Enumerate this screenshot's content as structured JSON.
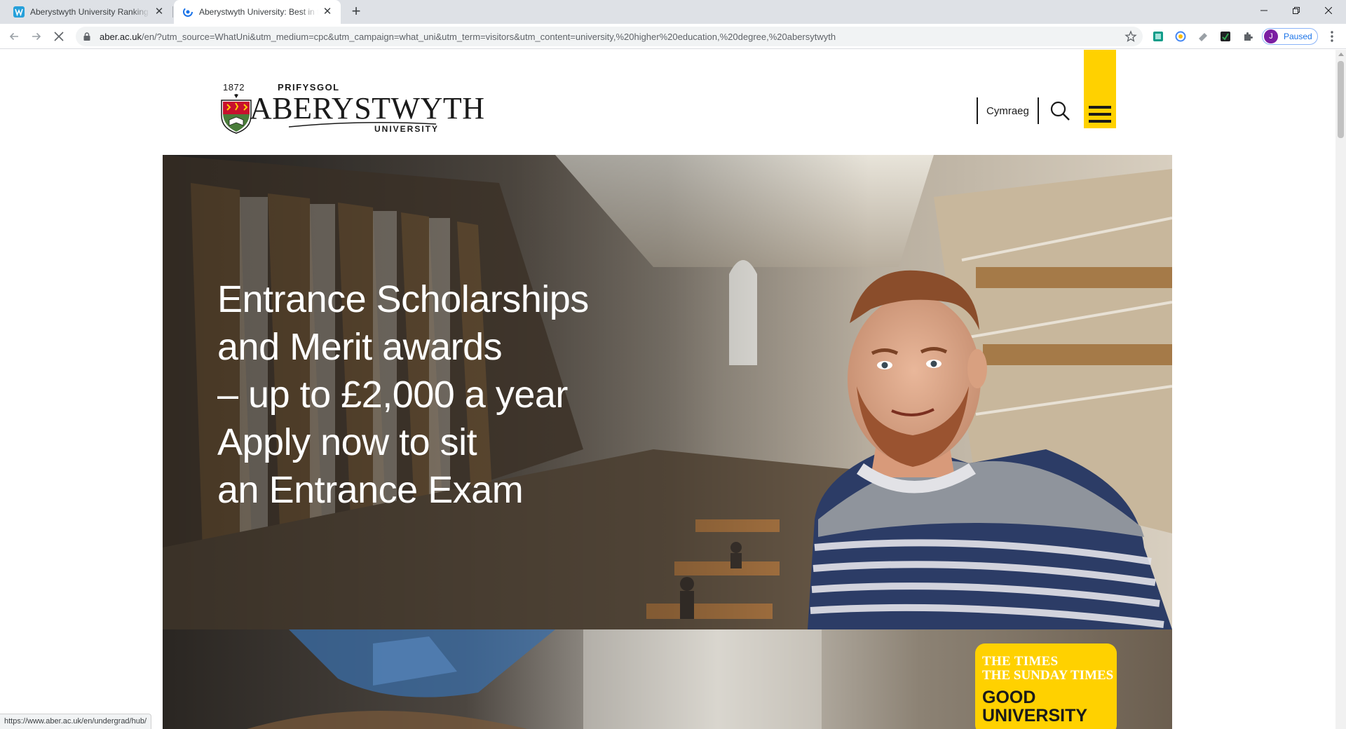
{
  "browser": {
    "tabs": [
      {
        "title": "Aberystwyth University Ranking &",
        "active": false
      },
      {
        "title": "Aberystwyth University: Best in th",
        "active": true
      }
    ],
    "url_domain": "aber.ac.uk",
    "url_rest": "/en/?utm_source=WhatUni&utm_medium=cpc&utm_campaign=what_uni&utm_term=visitors&utm_content=university,%20higher%20education,%20degree,%20abersytwyth",
    "profile_initial": "J",
    "profile_status": "Paused",
    "status_url": "https://www.aber.ac.uk/en/undergrad/hub/"
  },
  "header": {
    "logo": {
      "year": "1872",
      "top_word": "PRIFYSGOL",
      "main_word": "ABERYSTWYTH",
      "bottom_word": "UNIVERSITY"
    },
    "language_link": "Cymraeg",
    "accent_color": "#ffd100"
  },
  "hero": {
    "lines": [
      "Entrance Scholarships",
      "and Merit awards",
      "– up to £2,000 a year",
      "Apply now to sit",
      "an Entrance Exam"
    ]
  },
  "badge": {
    "line1": "THE TIMES",
    "line2": "THE SUNDAY TIMES",
    "line3": "GOOD",
    "line4": "UNIVERSITY"
  },
  "icons": {
    "back": "back-arrow-icon",
    "forward": "forward-arrow-icon",
    "stop": "stop-loading-icon",
    "lock": "lock-icon",
    "star": "bookmark-star-icon",
    "search": "search-icon",
    "menu": "hamburger-menu-icon"
  }
}
